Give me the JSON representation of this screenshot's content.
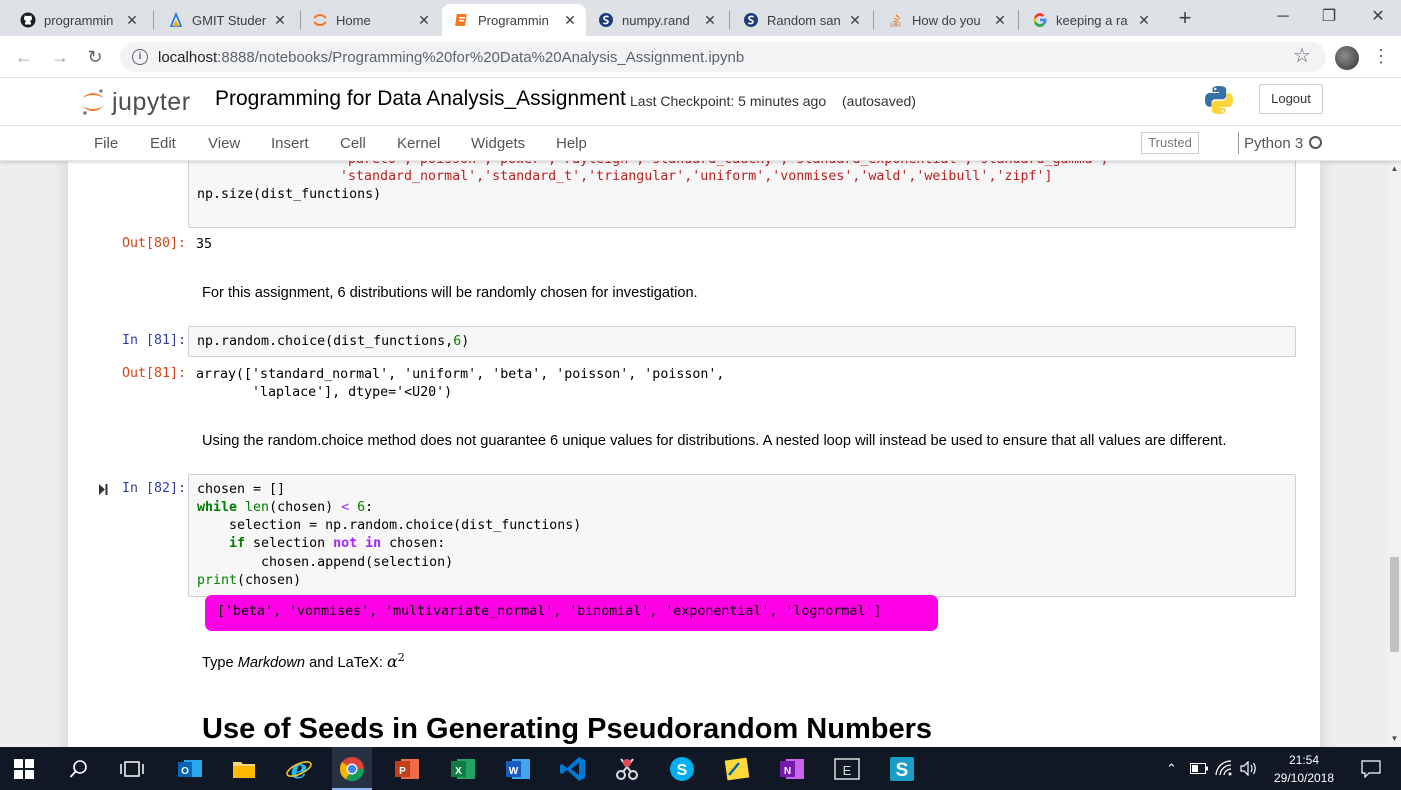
{
  "browser": {
    "tabs": [
      {
        "title": "programmin",
        "icon": "github-icon"
      },
      {
        "title": "GMIT Studer",
        "icon": "gmit-icon"
      },
      {
        "title": "Home",
        "icon": "jupyter-home-icon"
      },
      {
        "title": "Programmin",
        "icon": "notebook-icon",
        "active": true
      },
      {
        "title": "numpy.rand",
        "icon": "scipy-icon"
      },
      {
        "title": "Random san",
        "icon": "scipy-icon"
      },
      {
        "title": "How do you",
        "icon": "stackoverflow-icon"
      },
      {
        "title": "keeping a ra",
        "icon": "google-icon"
      }
    ],
    "new_tab": "+",
    "url_host": "localhost",
    "url_path": ":8888/notebooks/Programming%20for%20Data%20Analysis_Assignment.ipynb"
  },
  "jupyter": {
    "logo_text": "jupyter",
    "notebook_name": "Programming for Data Analysis_Assignment",
    "checkpoint": "Last Checkpoint: 5 minutes ago",
    "autosave": "(autosaved)",
    "logout": "Logout",
    "menu": [
      "File",
      "Edit",
      "View",
      "Insert",
      "Cell",
      "Kernel",
      "Widgets",
      "Help"
    ],
    "trusted": "Trusted",
    "kernel": "Python 3"
  },
  "cells": {
    "c80_partial_line": "'pareto','poisson','power','rayleigh','standard_cauchy','standard_exponential','standard_gamma',",
    "c80_line1": "'standard_normal','standard_t','triangular','uniform','vonmises','wald','weibull','zipf']",
    "c80_line2_fn": "np.size",
    "c80_line2_arg": "dist_functions",
    "out80_prompt": "Out[80]:",
    "out80": "35",
    "md1": "For this assignment, 6 distributions will be randomly chosen for investigation.",
    "in81_prompt": "In [81]:",
    "in81_code": "np.random.choice(dist_functions,",
    "in81_num": "6",
    "out81_prompt": "Out[81]:",
    "out81_line1": "array(['standard_normal', 'uniform', 'beta', 'poisson', 'poisson',",
    "out81_line2": "       'laplace'], dtype='<U20')",
    "md2": "Using the random.choice method does not guarantee 6 unique values for distributions. A nested loop will instead be used to ensure that all values are different.",
    "in82_prompt": "In [82]:",
    "in82_l1": "chosen = []",
    "in82_l2a": "while",
    "in82_l2b": " len",
    "in82_l2c": "(chosen) ",
    "in82_l2d": "<",
    "in82_l2e": " 6",
    "in82_l2f": ":",
    "in82_l3": "    selection = np.random.choice(dist_functions)",
    "in82_l4a": "    if",
    "in82_l4b": " selection ",
    "in82_l4c": "not in",
    "in82_l4d": " chosen:",
    "in82_l5": "        chosen.append(selection)",
    "in82_l6a": "print",
    "in82_l6b": "(chosen)",
    "out82": "['beta', 'vonmises', 'multivariate_normal', 'binomial', 'exponential', 'lognormal']",
    "md3_a": "Type ",
    "md3_b": "Markdown",
    "md3_c": " and LaTeX: ",
    "md3_alpha": "α",
    "md3_sup": "2",
    "heading": "Use of Seeds in Generating Pseudorandom Numbers"
  },
  "taskbar": {
    "time": "21:54",
    "date": "29/10/2018"
  },
  "colors": {
    "output_highlight": "#ff00e6",
    "prompt_in": "#303f9f",
    "prompt_out": "#d84315",
    "taskbar": "#101725"
  }
}
